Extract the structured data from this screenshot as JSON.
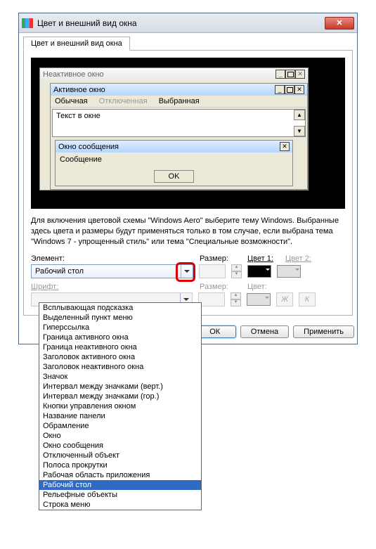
{
  "window": {
    "title": "Цвет и внешний вид окна",
    "tab": "Цвет и внешний вид окна"
  },
  "preview": {
    "inactive_title": "Неактивное окно",
    "active_title": "Активное окно",
    "menu_normal": "Обычная",
    "menu_disabled": "Отключенная",
    "menu_selected": "Выбранная",
    "text_in_window": "Текст в окне",
    "msg_title": "Окно сообщения",
    "msg_body": "Сообщение",
    "ok": "OK"
  },
  "description": "Для включения цветовой схемы \"Windows Aero\" выберите тему Windows. Выбранные здесь цвета и размеры будут применяться только в том случае, если выбрана тема \"Windows 7 - упрощенный стиль\" или тема \"Специальные возможности\".",
  "labels": {
    "element": "Элемент:",
    "size": "Размер:",
    "color1": "Цвет 1:",
    "color2": "Цвет 2:",
    "font": "Шрифт:",
    "color": "Цвет:"
  },
  "element_selected": "Рабочий стол",
  "style_bold": "Ж",
  "style_italic": "К",
  "dropdown_items": [
    "Всплывающая подсказка",
    "Выделенный пункт меню",
    "Гиперссылка",
    "Граница активного окна",
    "Граница неактивного окна",
    "Заголовок активного окна",
    "Заголовок неактивного окна",
    "Значок",
    "Интервал между значками (верт.)",
    "Интервал между значками (гор.)",
    "Кнопки управления окном",
    "Название панели",
    "Обрамление",
    "Окно",
    "Окно сообщения",
    "Отключенный объект",
    "Полоса прокрутки",
    "Рабочая область приложения",
    "Рабочий стол",
    "Рельефные объекты",
    "Строка меню"
  ],
  "dropdown_selected_index": 18,
  "buttons": {
    "ok": "ОК",
    "cancel": "Отмена",
    "apply": "Применить"
  }
}
